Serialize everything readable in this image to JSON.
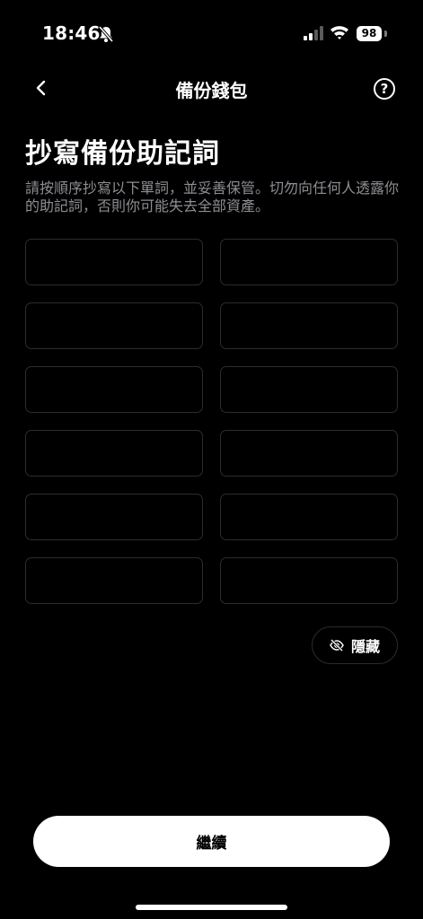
{
  "status_bar": {
    "time": "18:46",
    "battery": "98",
    "icons": [
      "bell-slash-icon",
      "signal-icon",
      "wifi-icon",
      "battery-icon"
    ]
  },
  "nav": {
    "title": "備份錢包",
    "help_label": "?"
  },
  "content": {
    "heading": "抄寫備份助記詞",
    "description": "請按順序抄寫以下單詞，並妥善保管。切勿向任何人透露你的助記詞，否則你可能失去全部資產。",
    "word_slots": [
      "",
      "",
      "",
      "",
      "",
      "",
      "",
      "",
      "",
      "",
      "",
      ""
    ]
  },
  "hide_button": {
    "label": "隱藏",
    "icon": "eye-slash-icon"
  },
  "continue_button": {
    "label": "繼續"
  },
  "colors": {
    "background": "#000000",
    "text": "#ffffff",
    "muted_text": "#8e8e93",
    "slot_border": "#2c2c2e",
    "button_bg": "#ffffff"
  }
}
